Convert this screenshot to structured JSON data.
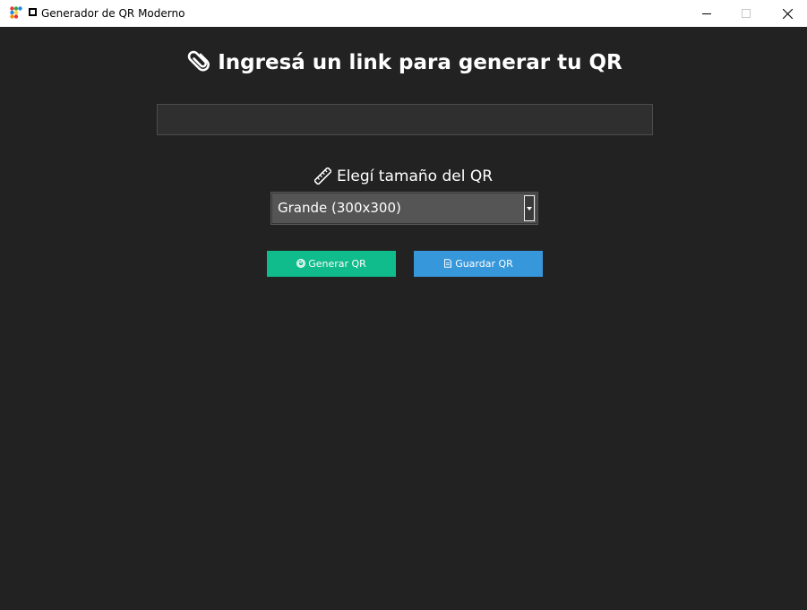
{
  "window": {
    "title": "Generador de QR Moderno"
  },
  "heading": {
    "icon": "paperclip-emoji",
    "text": "Ingresá un link para generar tu QR"
  },
  "link_input": {
    "value": "",
    "placeholder": ""
  },
  "size": {
    "icon": "ruler-emoji",
    "label": "Elegí tamaño del QR",
    "selected": "Grande (300x300)"
  },
  "buttons": {
    "generate": {
      "icon": "cyclone-emoji",
      "label": "Generar QR",
      "color": "#10bb8c"
    },
    "save": {
      "icon": "page-emoji",
      "label": "Guardar QR",
      "color": "#3797db"
    }
  },
  "colors": {
    "background": "#222222",
    "input": "#2f2f2f",
    "select": "#555555"
  }
}
